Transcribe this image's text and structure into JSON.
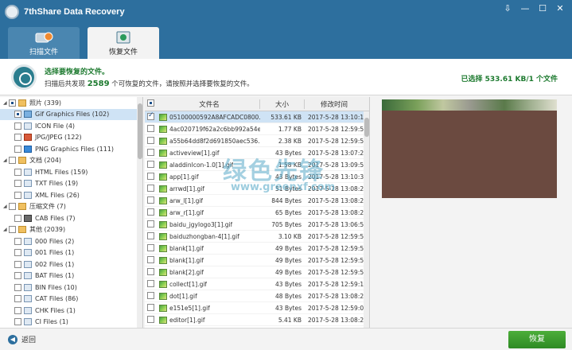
{
  "window": {
    "title": "7thShare Data Recovery",
    "buttons": [
      "⇩",
      "—",
      "☐",
      "✕"
    ]
  },
  "tabs": [
    {
      "label": "扫描文件",
      "icon": "disk-scan-icon"
    },
    {
      "label": "恢复文件",
      "icon": "recover-files-icon"
    }
  ],
  "info": {
    "title": "选择要恢复的文件。",
    "sub_prefix": "扫描后共发现",
    "count": "2589",
    "sub_suffix": "个可恢复的文件，请按照并选择要恢复的文件。",
    "selected": "已选择 533.61 KB/1 个文件"
  },
  "tree": [
    {
      "level": 0,
      "twisty": "◢",
      "check": "partial",
      "icon": "folder",
      "label": "照片 (339)"
    },
    {
      "level": 1,
      "twisty": "",
      "check": "partial",
      "icon": "img",
      "label": "Gif Graphics Files (102)",
      "selected": true
    },
    {
      "level": 1,
      "twisty": "",
      "check": "",
      "icon": "doc",
      "label": "ICON File (4)"
    },
    {
      "level": 1,
      "twisty": "",
      "check": "",
      "icon": "jpg",
      "label": "JPG/JPEG (122)"
    },
    {
      "level": 1,
      "twisty": "",
      "check": "",
      "icon": "png",
      "label": "PNG Graphics Files (111)"
    },
    {
      "level": 0,
      "twisty": "◢",
      "check": "",
      "icon": "folder",
      "label": "文档 (204)"
    },
    {
      "level": 1,
      "twisty": "",
      "check": "",
      "icon": "doc",
      "label": "HTML Files (159)"
    },
    {
      "level": 1,
      "twisty": "",
      "check": "",
      "icon": "doc",
      "label": "TXT Files (19)"
    },
    {
      "level": 1,
      "twisty": "",
      "check": "",
      "icon": "doc",
      "label": "XML Files (26)"
    },
    {
      "level": 0,
      "twisty": "◢",
      "check": "",
      "icon": "folder",
      "label": "压缩文件 (7)"
    },
    {
      "level": 1,
      "twisty": "",
      "check": "",
      "icon": "zip",
      "label": "CAB Files (7)"
    },
    {
      "level": 0,
      "twisty": "◢",
      "check": "",
      "icon": "folder",
      "label": "其他 (2039)"
    },
    {
      "level": 1,
      "twisty": "",
      "check": "",
      "icon": "doc",
      "label": "000 Files (2)"
    },
    {
      "level": 1,
      "twisty": "",
      "check": "",
      "icon": "doc",
      "label": "001 Files (1)"
    },
    {
      "level": 1,
      "twisty": "",
      "check": "",
      "icon": "doc",
      "label": "002 Files (1)"
    },
    {
      "level": 1,
      "twisty": "",
      "check": "",
      "icon": "doc",
      "label": "BAT Files (1)"
    },
    {
      "level": 1,
      "twisty": "",
      "check": "",
      "icon": "doc",
      "label": "BIN Files (10)"
    },
    {
      "level": 1,
      "twisty": "",
      "check": "",
      "icon": "doc",
      "label": "CAT Files (86)"
    },
    {
      "level": 1,
      "twisty": "",
      "check": "",
      "icon": "doc",
      "label": "CHK Files (1)"
    },
    {
      "level": 1,
      "twisty": "",
      "check": "",
      "icon": "doc",
      "label": "CI Files (1)"
    }
  ],
  "filelist": {
    "headers": {
      "name": "文件名",
      "size": "大小",
      "date": "修改时间"
    },
    "rows": [
      {
        "checked": true,
        "name": "05100000592A8AFCADC0800...",
        "size": "533.61 KB",
        "date": "2017-5-28 13:10:18",
        "selected": true
      },
      {
        "checked": false,
        "name": "4ac020719f62a2c6bb992a54e...",
        "size": "1.77 KB",
        "date": "2017-5-28 12:59:56"
      },
      {
        "checked": false,
        "name": "a55b64dd8f2d691850aec536...",
        "size": "2.38 KB",
        "date": "2017-5-28 12:59:56"
      },
      {
        "checked": false,
        "name": "activeview[1].gif",
        "size": "43 Bytes",
        "date": "2017-5-28 13:07:27"
      },
      {
        "checked": false,
        "name": "aladdinIcon-1.0[1].gif",
        "size": "1.58 KB",
        "date": "2017-5-28 13:09:58"
      },
      {
        "checked": false,
        "name": "app[1].gif",
        "size": "43 Bytes",
        "date": "2017-5-28 13:10:37"
      },
      {
        "checked": false,
        "name": "arrwd[1].gif",
        "size": "51 Bytes",
        "date": "2017-5-28 13:08:26"
      },
      {
        "checked": false,
        "name": "arw_l[1].gif",
        "size": "844 Bytes",
        "date": "2017-5-28 13:08:26"
      },
      {
        "checked": false,
        "name": "arw_r[1].gif",
        "size": "65 Bytes",
        "date": "2017-5-28 13:08:26"
      },
      {
        "checked": false,
        "name": "baidu_jgylogo3[1].gif",
        "size": "705 Bytes",
        "date": "2017-5-28 13:06:50"
      },
      {
        "checked": false,
        "name": "baiduzhongban-4[1].gif",
        "size": "3.10 KB",
        "date": "2017-5-28 12:59:56"
      },
      {
        "checked": false,
        "name": "blank[1].gif",
        "size": "49 Bytes",
        "date": "2017-5-28 12:59:56"
      },
      {
        "checked": false,
        "name": "blank[1].gif",
        "size": "49 Bytes",
        "date": "2017-5-28 12:59:56"
      },
      {
        "checked": false,
        "name": "blank[2].gif",
        "size": "49 Bytes",
        "date": "2017-5-28 12:59:56"
      },
      {
        "checked": false,
        "name": "collect[1].gif",
        "size": "43 Bytes",
        "date": "2017-5-28 12:59:15"
      },
      {
        "checked": false,
        "name": "dot[1].gif",
        "size": "48 Bytes",
        "date": "2017-5-28 13:08:26"
      },
      {
        "checked": false,
        "name": "e151e5[1].gif",
        "size": "43 Bytes",
        "date": "2017-5-28 12:59:00"
      },
      {
        "checked": false,
        "name": "editor[1].gif",
        "size": "5.41 KB",
        "date": "2017-5-28 13:08:26"
      }
    ]
  },
  "watermark": {
    "big": "绿色先锋",
    "url": "www.greenxf.com"
  },
  "footer": {
    "back": "返回",
    "recover": "恢复"
  },
  "colors": {
    "titlebar": "#2d6f9e",
    "accent_green": "#1d7a2f",
    "recover_button": "#3a9c2e"
  }
}
